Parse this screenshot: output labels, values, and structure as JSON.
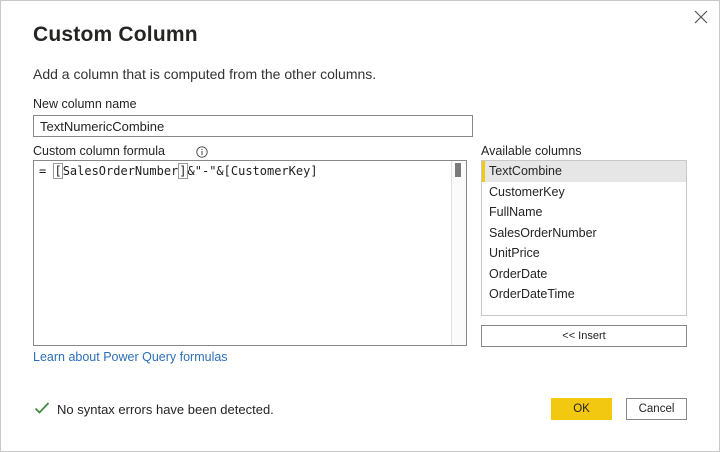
{
  "dialog": {
    "title": "Custom Column",
    "description": "Add a column that is computed from the other columns.",
    "close_icon": "close-icon"
  },
  "new_column": {
    "label": "New column name",
    "value": "TextNumericCombine"
  },
  "formula": {
    "label": "Custom column formula",
    "info_icon": "info-icon",
    "prefix": "= ",
    "open_bracket": "[",
    "column_ref": "SalesOrderNumber",
    "close_bracket": "]",
    "rest": "&\"-\"&[CustomerKey]"
  },
  "available_columns": {
    "label": "Available columns",
    "items": [
      "TextCombine",
      "CustomerKey",
      "FullName",
      "SalesOrderNumber",
      "UnitPrice",
      "OrderDate",
      "OrderDateTime"
    ],
    "selected": "TextCombine"
  },
  "insert_button": "<< Insert",
  "learn_link": "Learn about Power Query formulas",
  "status": {
    "icon": "checkmark-icon",
    "text": "No syntax errors have been detected."
  },
  "buttons": {
    "ok": "OK",
    "cancel": "Cancel"
  },
  "colors": {
    "accent": "#f2c811",
    "link": "#2d6fb7",
    "success": "#3f8c3f"
  }
}
